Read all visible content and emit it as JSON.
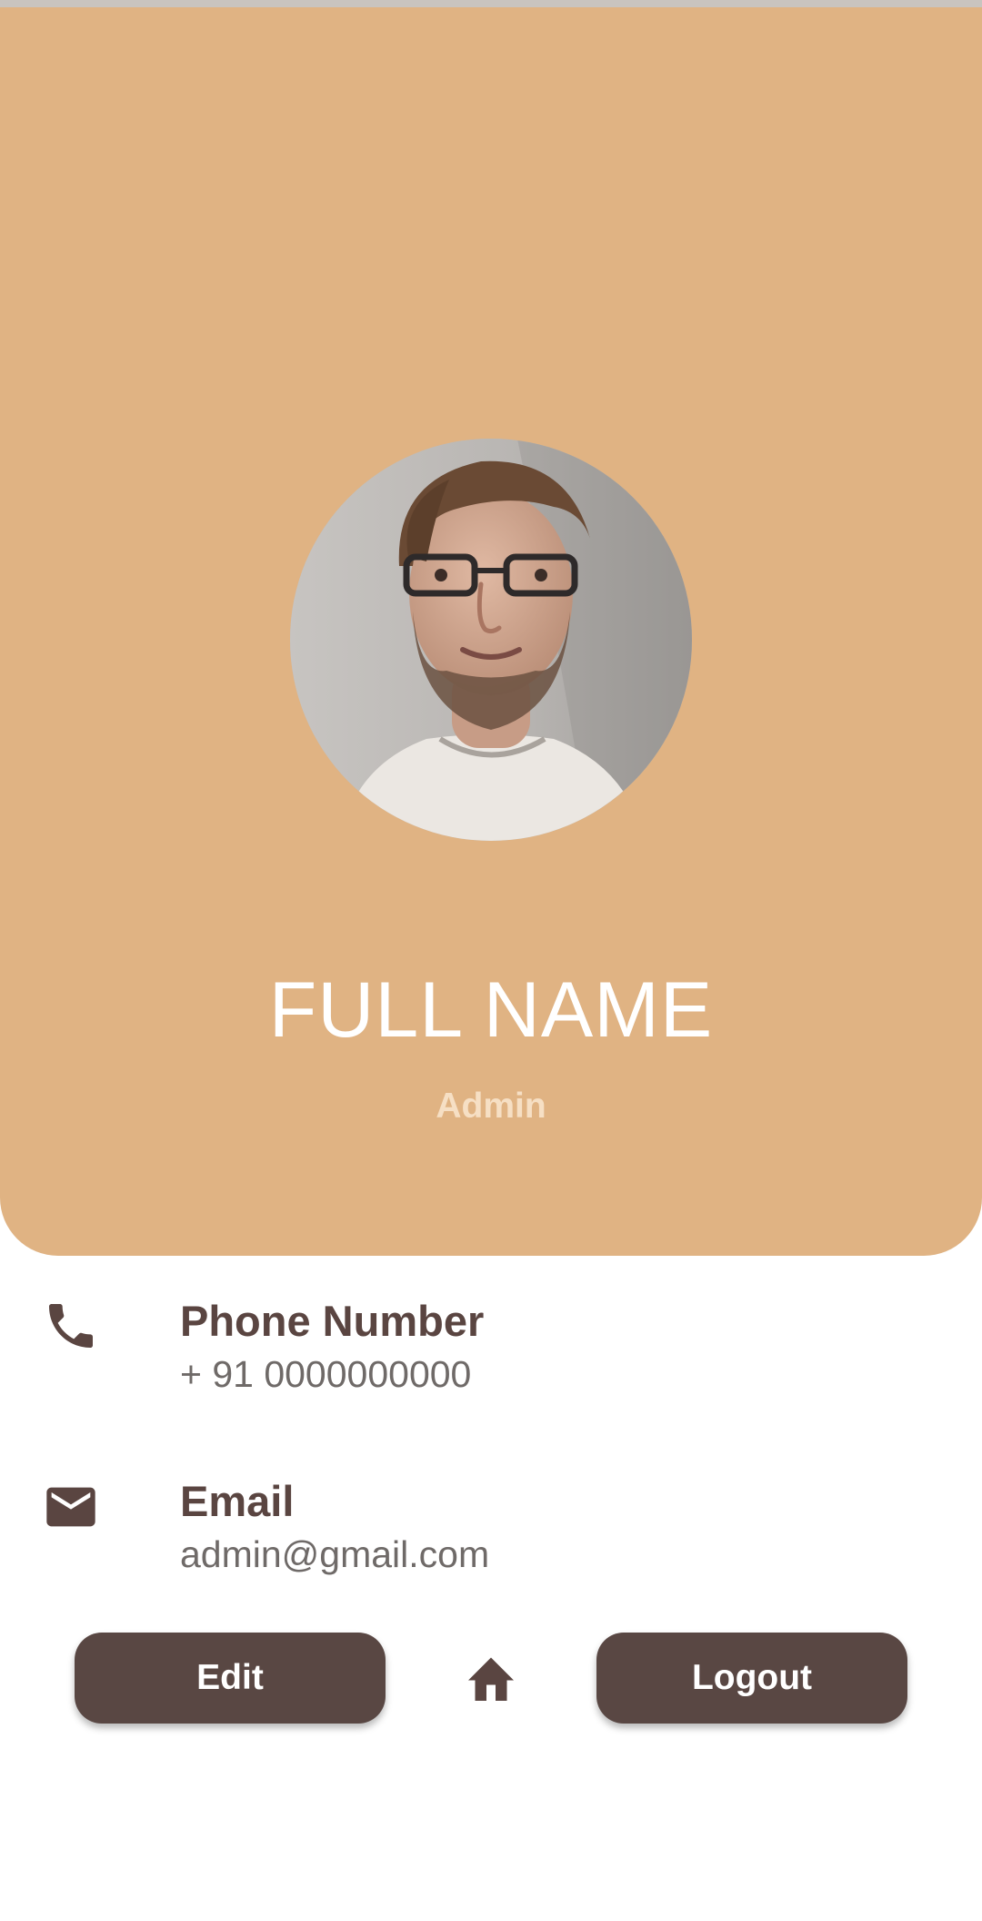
{
  "profile": {
    "full_name": "FULL NAME",
    "role": "Admin"
  },
  "contact": {
    "phone_title": "Phone Number",
    "phone_value": "+ 91 0000000000",
    "email_title": "Email",
    "email_value": "admin@gmail.com"
  },
  "actions": {
    "edit_label": "Edit",
    "logout_label": "Logout"
  },
  "icons": {
    "phone": "phone-icon",
    "email": "mail-icon",
    "home": "home-icon"
  },
  "colors": {
    "header_background": "#e0b383",
    "button_background": "#594743",
    "title_text": "#5a4541",
    "role_text": "#f6dfc4"
  }
}
